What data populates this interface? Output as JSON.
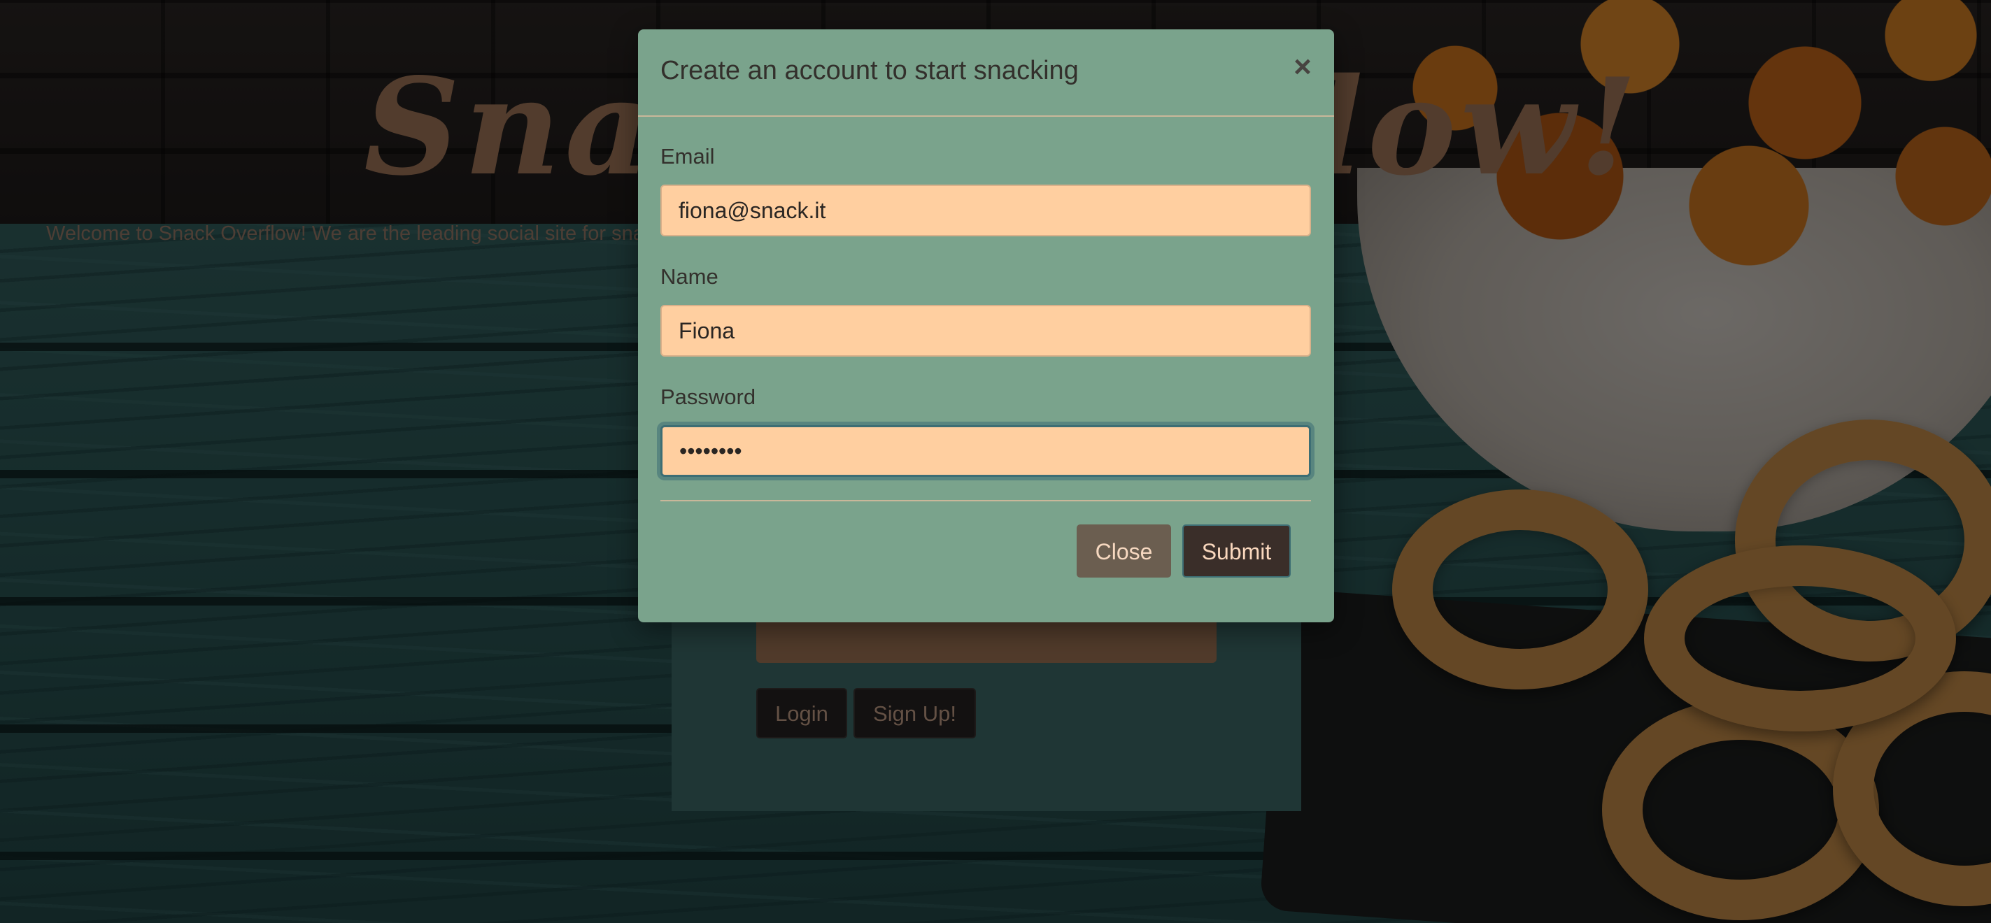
{
  "background": {
    "title": "Snack Overflow!",
    "tagline": "Welcome to Snack Overflow! We are the leading social site for snack lovers. Share your snacking hotspots and discuss with fellow enthusiasts.",
    "login_button": "Login",
    "signup_button": "Sign Up!"
  },
  "modal": {
    "title": "Create an account to start snacking",
    "close_icon": "×",
    "fields": {
      "email": {
        "label": "Email",
        "value": "fiona@snack.it"
      },
      "name": {
        "label": "Name",
        "value": "Fiona"
      },
      "password": {
        "label": "Password",
        "value": "••••••••"
      }
    },
    "close_button": "Close",
    "submit_button": "Submit"
  },
  "colors": {
    "modal_bg": "#7aa38c",
    "input_bg": "#ffcfa0",
    "close_button_bg": "#6b5e50",
    "submit_button_bg": "#3a2e29",
    "focus_ring": "#3d6e74"
  }
}
